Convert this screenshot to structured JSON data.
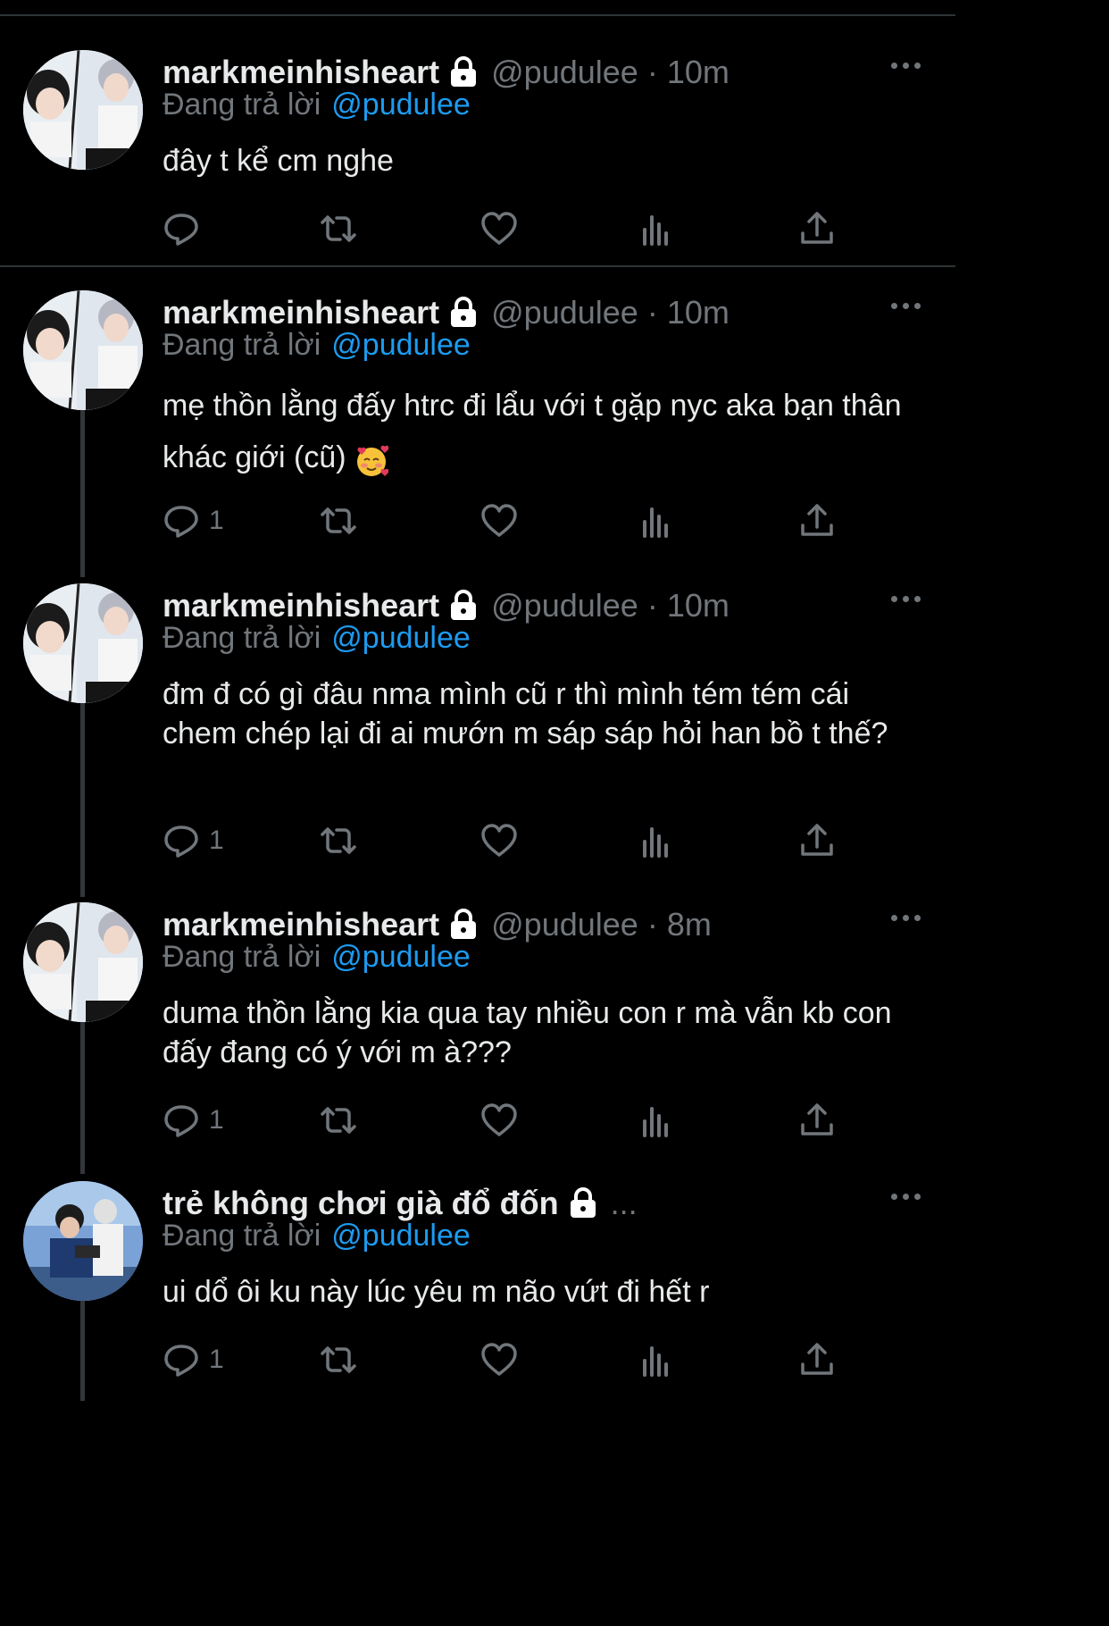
{
  "tweets": [
    {
      "name": "markmeinhisheart",
      "handle": "@pudulee",
      "time": "10m",
      "reply_label": "Đang trả lời",
      "reply_to": "@pudulee",
      "text": "đây t kể cm nghe",
      "reply_count": ""
    },
    {
      "name": "markmeinhisheart",
      "handle": "@pudulee",
      "time": "10m",
      "reply_label": "Đang trả lời",
      "reply_to": "@pudulee",
      "text": "mẹ thồn lằng đấy htrc đi lẩu với t gặp nyc aka bạn thân khác giới (cũ)",
      "reply_count": "1"
    },
    {
      "name": "markmeinhisheart",
      "handle": "@pudulee",
      "time": "10m",
      "reply_label": "Đang trả lời",
      "reply_to": "@pudulee",
      "text": "đm đ có gì đâu nma mình cũ r thì mình tém tém cái chem chép lại đi ai mướn m sáp sáp hỏi han bồ t thế?",
      "reply_count": "1"
    },
    {
      "name": "markmeinhisheart",
      "handle": "@pudulee",
      "time": "8m",
      "reply_label": "Đang trả lời",
      "reply_to": "@pudulee",
      "text": "duma thồn lằng kia qua tay nhiều con r mà vẫn kb con đấy đang có ý với m à???",
      "reply_count": "1"
    },
    {
      "name": "trẻ không chơi già đổ đốn",
      "handle": "...",
      "time": "",
      "reply_label": "Đang trả lời",
      "reply_to": "@pudulee",
      "text": "ui dổ ôi ku này lúc yêu m não vứt đi hết r",
      "reply_count": "1"
    }
  ],
  "icons": [
    "reply-icon",
    "retweet-icon",
    "like-icon",
    "views-icon",
    "share-icon",
    "lock-icon",
    "more-icon"
  ],
  "colors": {
    "background": "#000000",
    "text": "#e7e9ea",
    "muted": "#71767b",
    "accent": "#1d9bf0",
    "divider": "#2f3336"
  }
}
